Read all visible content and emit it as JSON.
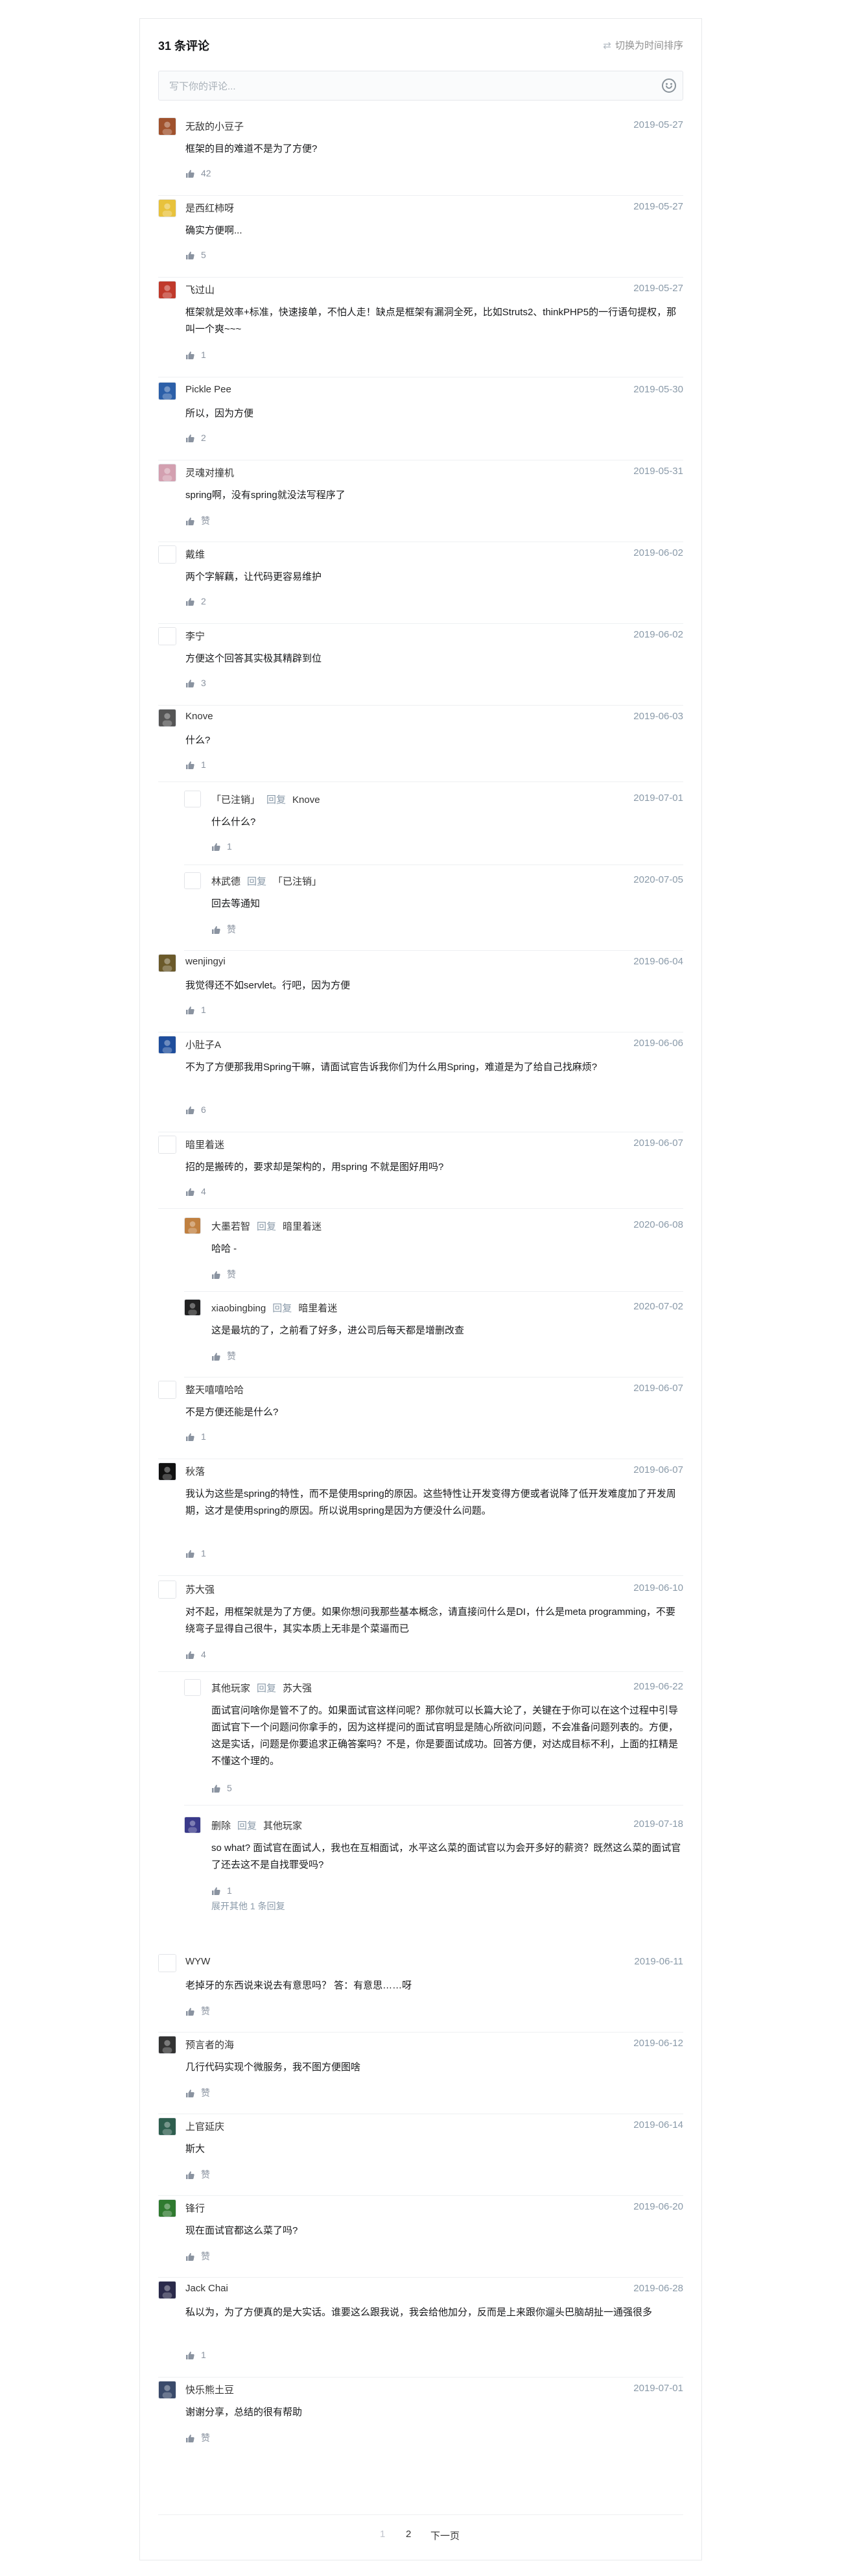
{
  "header": {
    "count_title": "31 条评论",
    "sort_label": "切换为时间排序",
    "sort_icon": "swap-arrows-icon"
  },
  "editor": {
    "placeholder": "写下你的评论...",
    "emoji_icon": "smile-icon"
  },
  "reply_label": "回复",
  "comments": [
    {
      "name": "无敌的小豆子",
      "date": "2019-05-27",
      "text": "框架的目的难道不是为了方便?",
      "likes": "42",
      "avatar_color": "#a0522d"
    },
    {
      "name": "是西红柿呀",
      "date": "2019-05-27",
      "text": "确实方便啊...",
      "likes": "5",
      "avatar_color": "#e8c23c"
    },
    {
      "name": "飞过山",
      "date": "2019-05-27",
      "text": "框架就是效率+标准，快速接单，不怕人走！缺点是框架有漏洞全死，比如Struts2、thinkPHP5的一行语句提权，那叫一个爽~~~",
      "likes": "1",
      "avatar_color": "#c0392b"
    },
    {
      "name": "Pickle Pee",
      "date": "2019-05-30",
      "text": "所以，因为方便",
      "likes": "2",
      "avatar_color": "#2c5fa8"
    },
    {
      "name": "灵魂对撞机",
      "date": "2019-05-31",
      "text": "spring啊，没有spring就没法写程序了",
      "likes": "赞",
      "avatar_color": "#d3a0b0"
    },
    {
      "name": "戴维",
      "date": "2019-06-02",
      "text": "两个字解藕，让代码更容易维护",
      "likes": "2",
      "avatar_color": "#ffffff"
    },
    {
      "name": "李宁",
      "date": "2019-06-02",
      "text": "方便这个回答其实极其精辟到位",
      "likes": "3",
      "avatar_color": "#ffffff"
    },
    {
      "name": "Knove",
      "date": "2019-06-03",
      "text": "什么?",
      "likes": "1",
      "avatar_color": "#555555"
    },
    {
      "name": "「已注销」",
      "reply_to": "Knove",
      "date": "2019-07-01",
      "text": "什么什么?",
      "likes": "1",
      "avatar_color": "#ffffff"
    },
    {
      "name": "林武德",
      "reply_to": "「已注销」",
      "date": "2020-07-05",
      "text": "回去等通知",
      "likes": "赞",
      "avatar_color": "#ffffff"
    },
    {
      "name": "wenjingyi",
      "date": "2019-06-04",
      "text": "我觉得还不如servlet。行吧，因为方便",
      "likes": "1",
      "avatar_color": "#6b5a2a"
    },
    {
      "name": "小肚子A",
      "date": "2019-06-06",
      "text": "不为了方便那我用Spring干嘛，请面试官告诉我你们为什么用Spring，难道是为了给自己找麻烦?",
      "likes": "6",
      "avatar_color": "#1f4e9c"
    },
    {
      "name": "暗里着迷",
      "date": "2019-06-07",
      "text": "招的是搬砖的，要求却是架构的，用spring 不就是图好用吗?",
      "likes": "4",
      "avatar_color": "#ffffff"
    },
    {
      "name": "大墨若智",
      "reply_to": "暗里着迷",
      "date": "2020-06-08",
      "text": "哈哈 -",
      "likes": "赞",
      "avatar_color": "#c08040"
    },
    {
      "name": "xiaobingbing",
      "reply_to": "暗里着迷",
      "date": "2020-07-02",
      "text": "这是最坑的了，之前看了好多，进公司后每天都是增删改查",
      "likes": "赞",
      "avatar_color": "#222222"
    },
    {
      "name": "整天嘻嘻哈哈",
      "date": "2019-06-07",
      "text": "不是方便还能是什么?",
      "likes": "1",
      "avatar_color": "#ffffff"
    },
    {
      "name": "秋落",
      "date": "2019-06-07",
      "text": "我认为这些是spring的特性，而不是使用spring的原因。这些特性让开发变得方便或者说降了低开发难度加了开发周期，这才是使用spring的原因。所以说用spring是因为方便没什么问题。",
      "likes": "1",
      "avatar_color": "#111111"
    },
    {
      "name": "苏大强",
      "date": "2019-06-10",
      "text": "对不起，用框架就是为了方便。如果你想问我那些基本概念，请直接问什么是DI，什么是meta programming，不要绕弯子显得自己很牛，其实本质上无非是个菜逼而已",
      "likes": "4",
      "avatar_color": "#ffffff"
    },
    {
      "name": "其他玩家",
      "reply_to": "苏大强",
      "date": "2019-06-22",
      "text": "面试官问啥你是管不了的。如果面试官这样问呢？那你就可以长篇大论了，关键在于你可以在这个过程中引导面试官下一个问题问你拿手的，因为这样提问的面试官明显是随心所欲问问题，不会准备问题列表的。方便，这是实话，问题是你要追求正确答案吗？不是，你是要面试成功。回答方便，对达成目标不利，上面的扛精是不懂这个理的。",
      "likes": "5",
      "avatar_color": "#ffffff"
    },
    {
      "name": "删除",
      "reply_to": "其他玩家",
      "date": "2019-07-18",
      "text": "so what? 面试官在面试人，我也在互相面试，水平这么菜的面试官以为会开多好的薪资？既然这么菜的面试官了还去这不是自找罪受吗?",
      "likes": "1",
      "avatar_color": "#3a3a8a"
    },
    {
      "name": "WYW",
      "date": "2019-06-11",
      "text": "老掉牙的东西说来说去有意思吗？ 答：有意思……呀",
      "likes": "赞",
      "avatar_color": "#ffffff"
    },
    {
      "name": "预言者的海",
      "date": "2019-06-12",
      "text": "几行代码实现个微服务，我不图方便图啥",
      "likes": "赞",
      "avatar_color": "#333333"
    },
    {
      "name": "上官延庆",
      "date": "2019-06-14",
      "text": "斯大",
      "likes": "赞",
      "avatar_color": "#2e5e4e"
    },
    {
      "name": "锋行",
      "date": "2019-06-20",
      "text": "现在面试官都这么菜了吗?",
      "likes": "赞",
      "avatar_color": "#2f7a2f"
    },
    {
      "name": "Jack Chai",
      "date": "2019-06-28",
      "text": "私以为，为了方便真的是大实话。谁要这么跟我说，我会给他加分，反而是上来跟你遛头巴脑胡扯一通强很多",
      "likes": "1",
      "avatar_color": "#2a2a4a"
    },
    {
      "name": "快乐熊土豆",
      "date": "2019-07-01",
      "text": "谢谢分享，总结的很有帮助",
      "likes": "赞",
      "avatar_color": "#3a4a6a"
    }
  ],
  "more_replies": "展开其他 1 条回复",
  "pagination": {
    "prev": "1",
    "current": "2",
    "next": "下一页"
  }
}
